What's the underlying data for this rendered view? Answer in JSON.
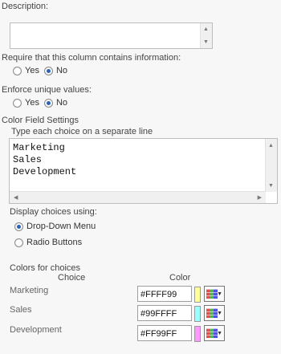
{
  "description": {
    "label": "Description:",
    "value": ""
  },
  "require": {
    "label": "Require that this column contains information:",
    "yes": "Yes",
    "no": "No",
    "selected": "No"
  },
  "unique": {
    "label": "Enforce unique values:",
    "yes": "Yes",
    "no": "No",
    "selected": "No"
  },
  "section_title": "Color Field Settings",
  "choices": {
    "hint": "Type each choice on a separate line",
    "lines": [
      "Marketing",
      "Sales",
      "Development"
    ]
  },
  "display": {
    "label": "Display choices using:",
    "options": [
      "Drop-Down Menu",
      "Radio Buttons"
    ],
    "selected": "Drop-Down Menu"
  },
  "colors": {
    "title": "Colors for choices",
    "col_choice": "Choice",
    "col_color": "Color",
    "rows": [
      {
        "choice": "Marketing",
        "value": "#FFFF99",
        "swatch": "#FFFF99"
      },
      {
        "choice": "Sales",
        "value": "#99FFFF",
        "swatch": "#99FFFF"
      },
      {
        "choice": "Development",
        "value": "#FF99FF",
        "swatch": "#FF99FF"
      }
    ]
  },
  "icons": {
    "scroll_up": "up-arrow-icon",
    "scroll_down": "down-arrow-icon",
    "scroll_left": "left-arrow-icon",
    "scroll_right": "right-arrow-icon",
    "color_picker": "color-picker-icon"
  }
}
